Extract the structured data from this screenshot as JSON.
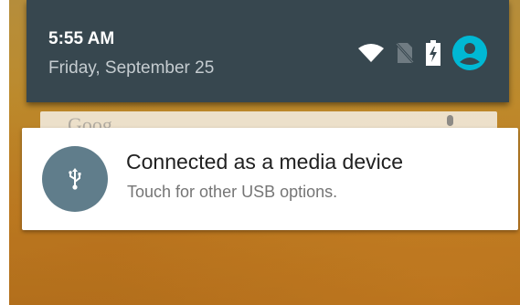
{
  "status_bar": {
    "time": "5:55 AM",
    "date": "Friday, September 25",
    "icons": [
      "wifi-icon",
      "no-sim-icon",
      "battery-charging-icon",
      "user-account-icon"
    ],
    "accent_color": "#00b8d4",
    "background_color": "#37474f"
  },
  "notification": {
    "icon": "usb-icon",
    "title": "Connected as a media device",
    "text": "Touch for other USB options.",
    "icon_background_color": "#607d8b"
  }
}
